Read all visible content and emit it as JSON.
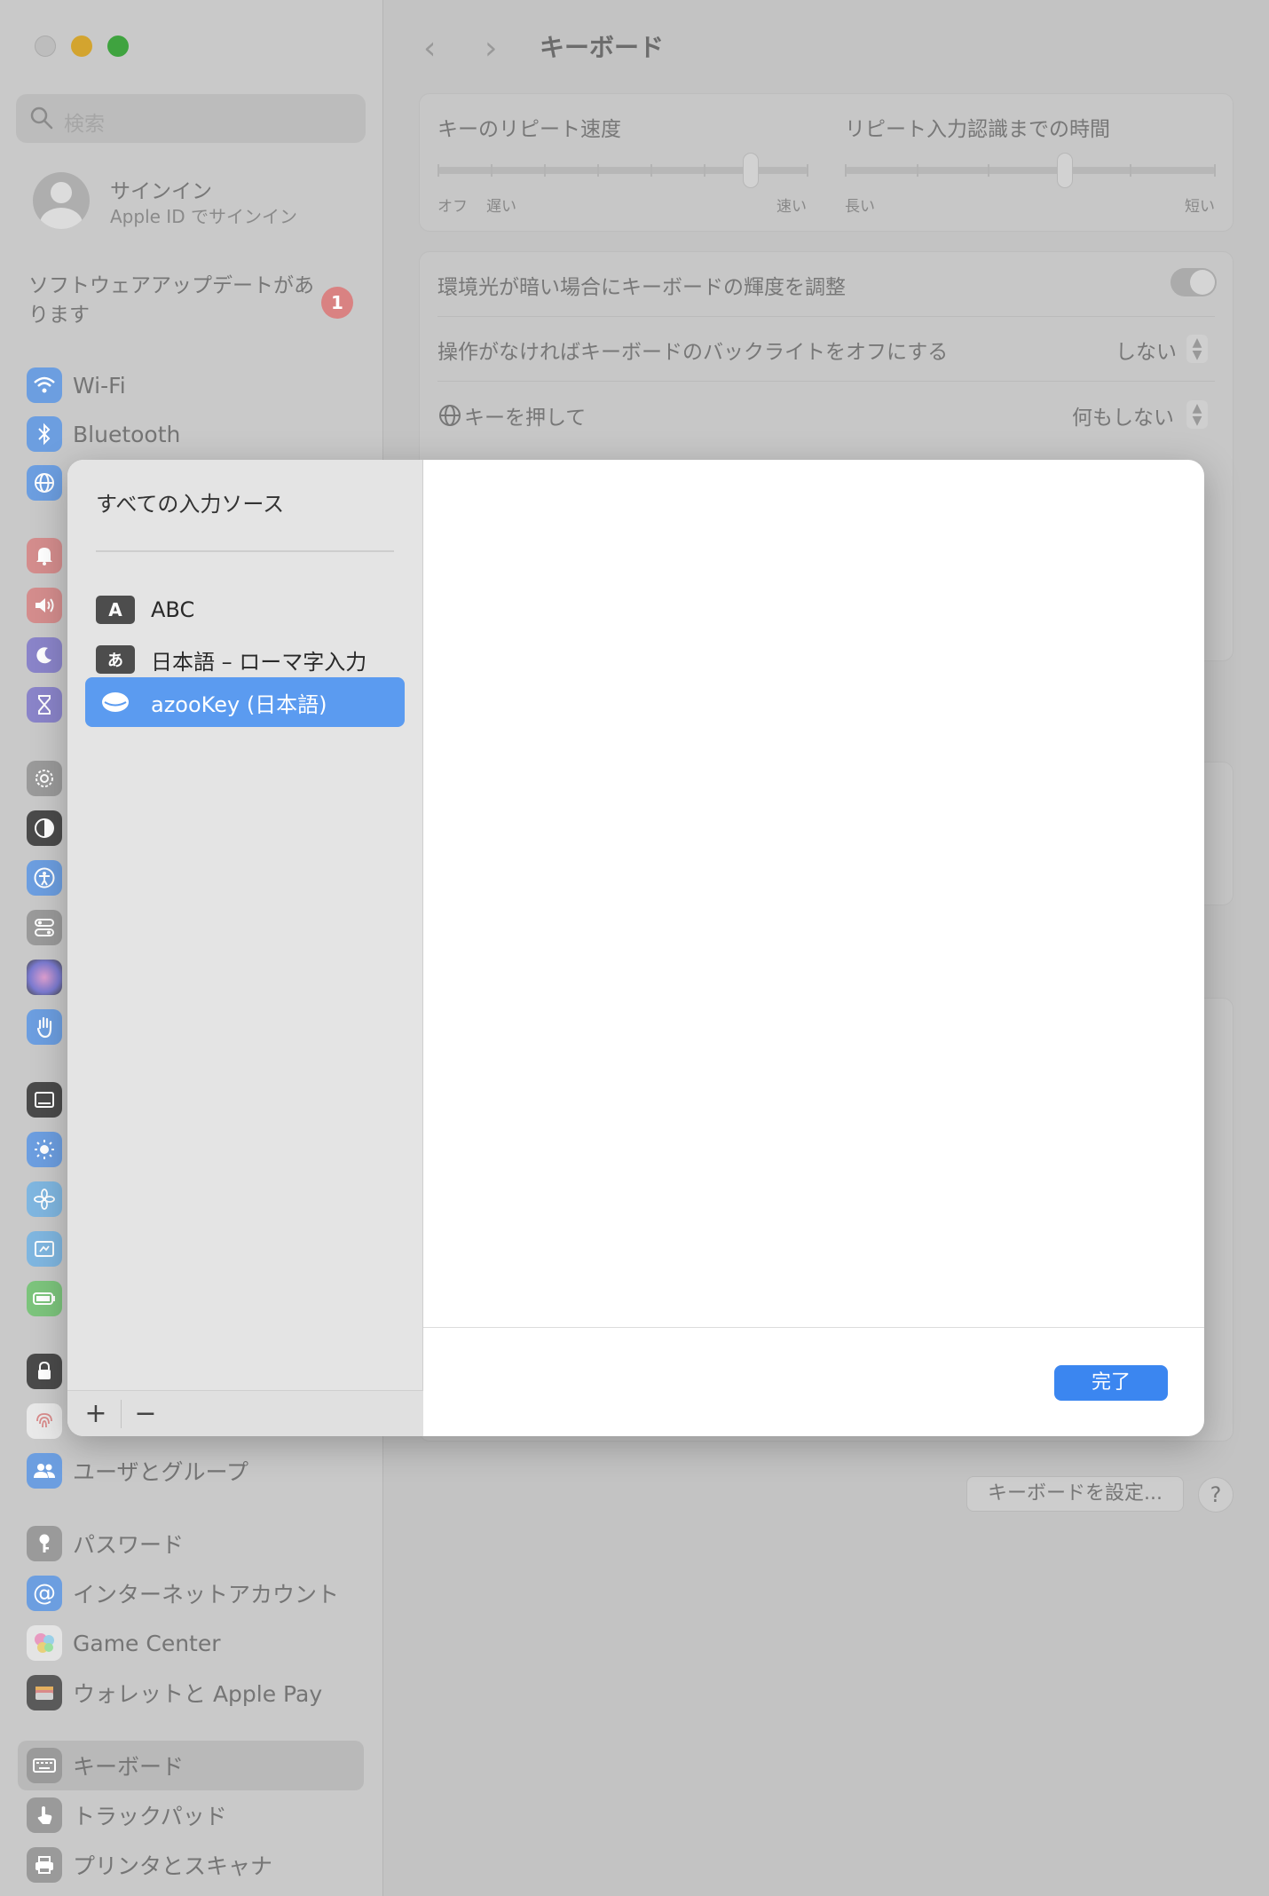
{
  "window": {
    "title": "キーボード",
    "search_placeholder": "検索"
  },
  "account": {
    "name": "サインイン",
    "subtitle": "Apple ID でサインイン"
  },
  "update": {
    "label": "ソフトウェアアップデートがあります",
    "badge": "1"
  },
  "sidebar": {
    "items": [
      {
        "label": "Wi-Fi",
        "icon": "wifi-icon",
        "color": "#6c9ee0"
      },
      {
        "label": "Bluetooth",
        "icon": "bluetooth-icon",
        "color": "#6c9ee0"
      },
      {
        "label": "ユーザとグループ",
        "icon": "users-icon",
        "color": "#6c9ee0"
      },
      {
        "label": "パスワード",
        "icon": "key-icon",
        "color": "#9a9a9a"
      },
      {
        "label": "インターネットアカウント",
        "icon": "at-icon",
        "color": "#6c9ee0"
      },
      {
        "label": "Game Center",
        "icon": "game-center-icon",
        "color": "#d0d0d0"
      },
      {
        "label": "ウォレットと Apple Pay",
        "icon": "wallet-icon",
        "color": "#7a7a7a"
      },
      {
        "label": "キーボード",
        "icon": "keyboard-icon",
        "color": "#9a9a9a"
      },
      {
        "label": "トラックパッド",
        "icon": "trackpad-icon",
        "color": "#9a9a9a"
      },
      {
        "label": "プリンタとスキャナ",
        "icon": "printer-icon",
        "color": "#9a9a9a"
      }
    ]
  },
  "repeat": {
    "key_repeat_label": "キーのリピート速度",
    "delay_label": "リピート入力認識までの時間",
    "off": "オフ",
    "slow": "遅い",
    "fast": "速い",
    "long": "長い",
    "short": "短い"
  },
  "settings": {
    "brightness_label": "環境光が暗い場合にキーボードの輝度を調整",
    "backlight_label": "操作がなければキーボードのバックライトをオフにする",
    "backlight_value": "しない",
    "globe_label": "キーを押して",
    "globe_value": "何もしない"
  },
  "footer": {
    "keyboard_setup": "キーボードを設定...",
    "help": "?"
  },
  "sheet": {
    "heading": "すべての入力ソース",
    "sources": [
      {
        "glyph": "A",
        "label": "ABC",
        "selected": false
      },
      {
        "glyph": "あ",
        "label": "日本語 – ローマ字入力",
        "selected": false
      },
      {
        "glyph": "",
        "label": "azooKey (日本語)",
        "selected": true
      }
    ],
    "add": "+",
    "remove": "−",
    "done": "完了",
    "accent": "#3b86f0"
  }
}
